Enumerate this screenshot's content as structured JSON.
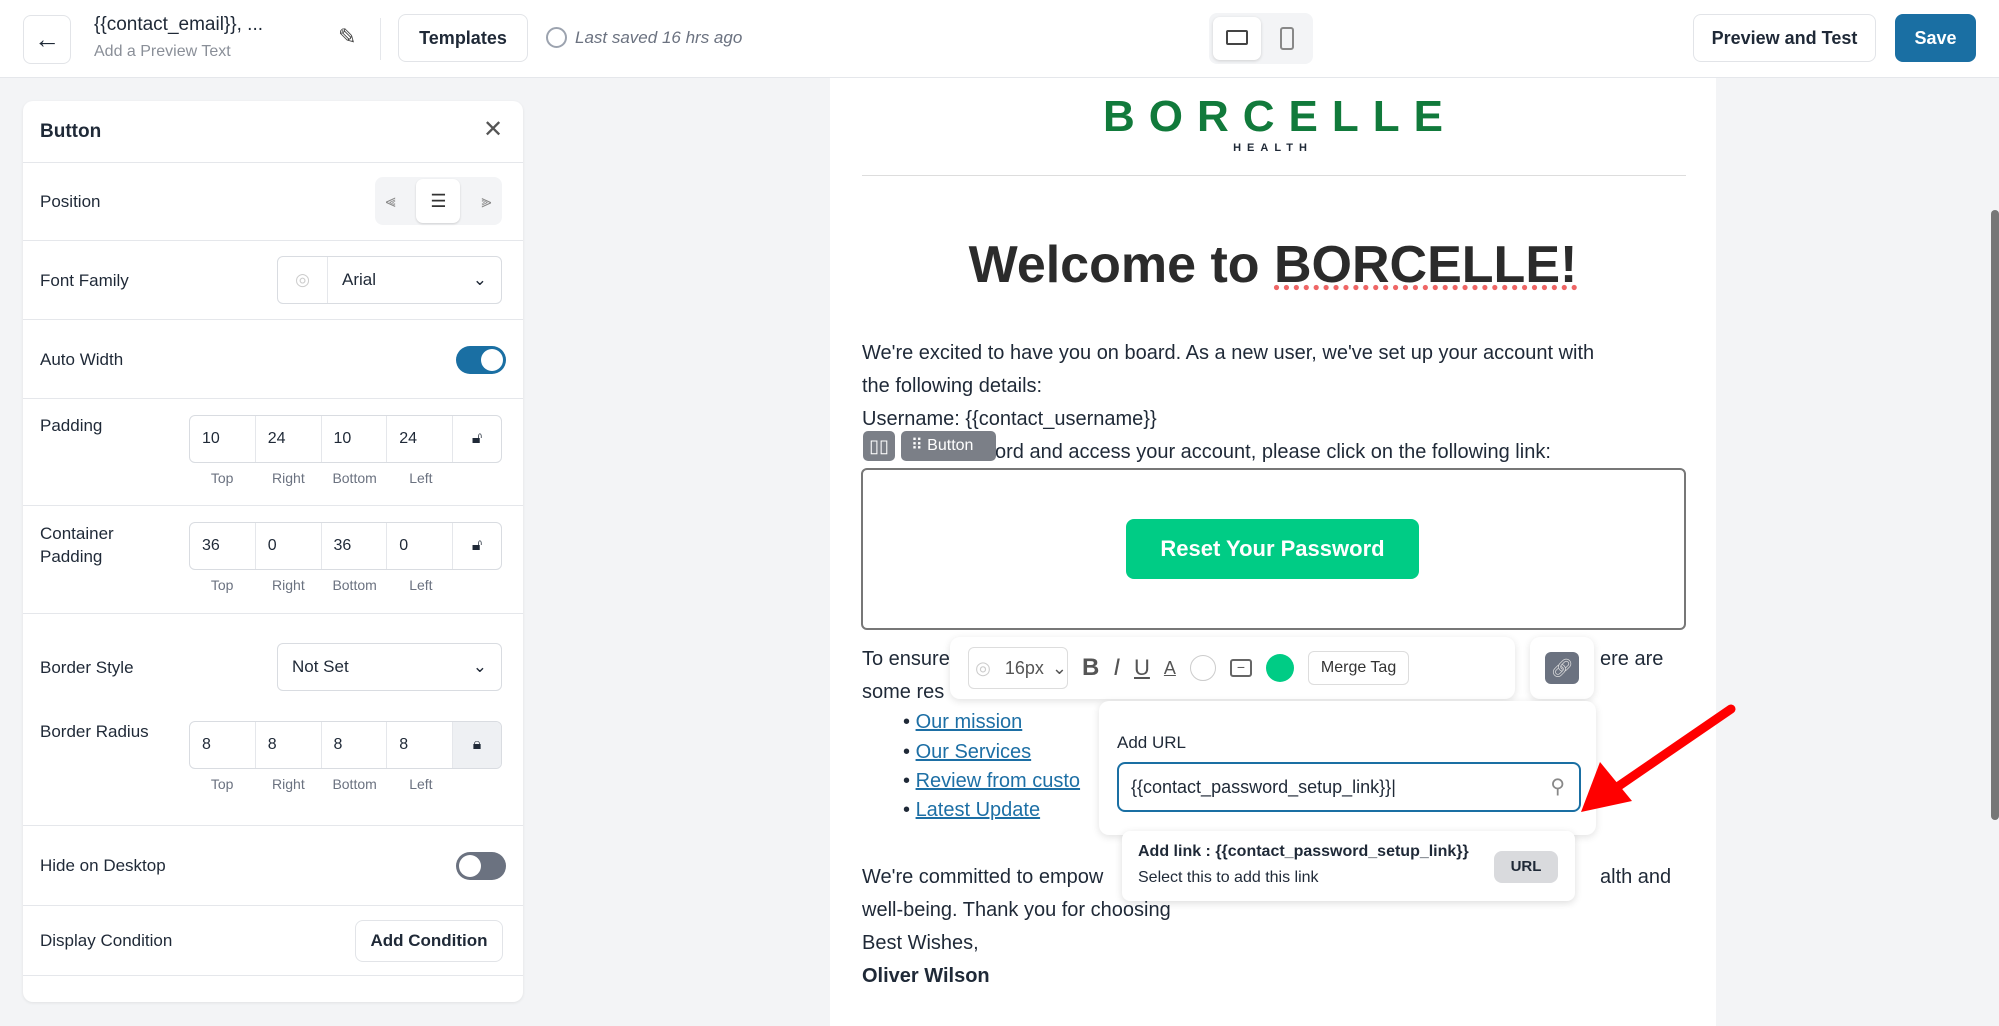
{
  "header": {
    "title": "{{contact_email}}, ...",
    "preview_text": "Add a Preview Text",
    "templates": "Templates",
    "last_saved": "Last saved 16 hrs ago",
    "preview_test": "Preview and Test",
    "save": "Save",
    "accent": "#1a6fa3"
  },
  "panel": {
    "title": "Button",
    "position": "Position",
    "font_family": "Font Family",
    "font_value": "Arial",
    "auto_width": "Auto Width",
    "auto_width_on": true,
    "padding": "Padding",
    "padding_values": [
      "10",
      "24",
      "10",
      "24"
    ],
    "container_padding": "Container Padding",
    "container_values": [
      "36",
      "0",
      "36",
      "0"
    ],
    "sides": [
      "Top",
      "Right",
      "Bottom",
      "Left"
    ],
    "border_style": "Border Style",
    "border_style_value": "Not Set",
    "border_radius": "Border Radius",
    "radius_values": [
      "8",
      "8",
      "8",
      "8"
    ],
    "hide_desktop": "Hide on Desktop",
    "hide_desktop_on": false,
    "display_condition": "Display Condition",
    "add_condition": "Add Condition"
  },
  "email": {
    "logo": "BORCELLE",
    "logo_sub": "HEALTH",
    "heading_a": "Welcome to ",
    "heading_b": "BORCELLE!",
    "lines": [
      "We're excited to have you on board. As a new user, we've set up your account with",
      "the following details:",
      "Username: {{contact_username}}",
      "asswword and access your account, please click on the following link:"
    ],
    "button_tag": "Button",
    "cta": "Reset Your Password",
    "cta_color": "#00cc85",
    "ensure": "To ensure",
    "ensure_tail": "ere are",
    "some": "some res",
    "bullets": [
      "Our mission ",
      "Our Services",
      "Review from custo",
      "Latest Update"
    ],
    "closing": [
      "We're committed to empow",
      "well-being. Thank you for choosing"
    ],
    "closing_tail": "alth and",
    "best": "Best Wishes,",
    "name": "Oliver Wilson"
  },
  "toolbar": {
    "font_size": "16px",
    "merge_tag": "Merge Tag",
    "bg_color": "#00cc85"
  },
  "link_popup": {
    "label": "Add URL",
    "value": "{{contact_password_setup_link}}",
    "suggest_title": "Add link : {{contact_password_setup_link}}",
    "suggest_sub": "Select this to add this link",
    "badge": "URL"
  }
}
